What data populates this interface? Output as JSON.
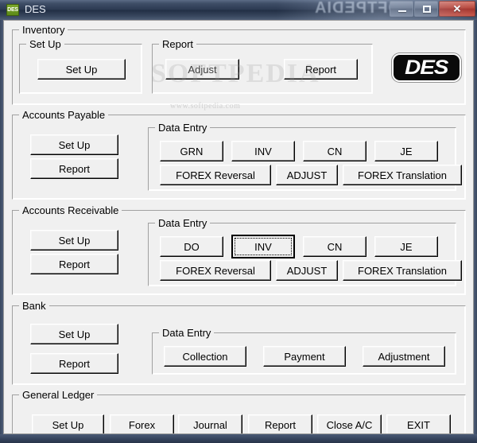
{
  "window": {
    "title": "DES",
    "icon_label": "DES",
    "icon_name": "des-app-icon",
    "watermark_title": "SOFTPEDIA",
    "controls": {
      "minimize": "minimize-icon",
      "maximize": "maximize-icon",
      "close": "✕"
    }
  },
  "watermark": {
    "main": "SOFTPEDIA",
    "sub": "www.softpedia.com"
  },
  "logo": {
    "text": "DES"
  },
  "sections": {
    "inventory": {
      "title": "Inventory",
      "setup_group": {
        "title": "Set Up",
        "buttons": [
          {
            "label": "Set Up",
            "name": "inventory-setup-button"
          }
        ]
      },
      "report_group": {
        "title": "Report",
        "buttons": [
          {
            "label": "Adjust",
            "name": "inventory-adjust-button"
          },
          {
            "label": "Report",
            "name": "inventory-report-button"
          }
        ]
      }
    },
    "accounts_payable": {
      "title": "Accounts Payable",
      "left_buttons": [
        {
          "label": "Set Up",
          "name": "ap-setup-button"
        },
        {
          "label": "Report",
          "name": "ap-report-button"
        }
      ],
      "data_entry": {
        "title": "Data Entry",
        "row1": [
          {
            "label": "GRN",
            "name": "ap-grn-button"
          },
          {
            "label": "INV",
            "name": "ap-inv-button"
          },
          {
            "label": "CN",
            "name": "ap-cn-button"
          },
          {
            "label": "JE",
            "name": "ap-je-button"
          }
        ],
        "row2": [
          {
            "label": "FOREX Reversal",
            "name": "ap-forex-reversal-button"
          },
          {
            "label": "ADJUST",
            "name": "ap-adjust-button"
          },
          {
            "label": "FOREX Translation",
            "name": "ap-forex-translation-button"
          }
        ]
      }
    },
    "accounts_receivable": {
      "title": "Accounts Receivable",
      "left_buttons": [
        {
          "label": "Set Up",
          "name": "ar-setup-button"
        },
        {
          "label": "Report",
          "name": "ar-report-button"
        }
      ],
      "data_entry": {
        "title": "Data Entry",
        "row1": [
          {
            "label": "DO",
            "name": "ar-do-button"
          },
          {
            "label": "INV",
            "name": "ar-inv-button"
          },
          {
            "label": "CN",
            "name": "ar-cn-button"
          },
          {
            "label": "JE",
            "name": "ar-je-button"
          }
        ],
        "row2": [
          {
            "label": "FOREX Reversal",
            "name": "ar-forex-reversal-button"
          },
          {
            "label": "ADJUST",
            "name": "ar-adjust-button"
          },
          {
            "label": "FOREX Translation",
            "name": "ar-forex-translation-button"
          }
        ]
      }
    },
    "bank": {
      "title": "Bank",
      "left_buttons": [
        {
          "label": "Set Up",
          "name": "bank-setup-button"
        },
        {
          "label": "Report",
          "name": "bank-report-button"
        }
      ],
      "data_entry": {
        "title": "Data Entry",
        "row1": [
          {
            "label": "Collection",
            "name": "bank-collection-button"
          },
          {
            "label": "Payment",
            "name": "bank-payment-button"
          },
          {
            "label": "Adjustment",
            "name": "bank-adjustment-button"
          }
        ]
      }
    },
    "general_ledger": {
      "title": "General Ledger",
      "buttons": [
        {
          "label": "Set Up",
          "name": "gl-setup-button"
        },
        {
          "label": "Forex",
          "name": "gl-forex-button"
        },
        {
          "label": "Journal",
          "name": "gl-journal-button"
        },
        {
          "label": "Report",
          "name": "gl-report-button"
        },
        {
          "label": "Close A/C",
          "name": "gl-close-ac-button"
        },
        {
          "label": "EXIT",
          "name": "gl-exit-button"
        }
      ]
    }
  },
  "focused_button": "ar-inv-button"
}
